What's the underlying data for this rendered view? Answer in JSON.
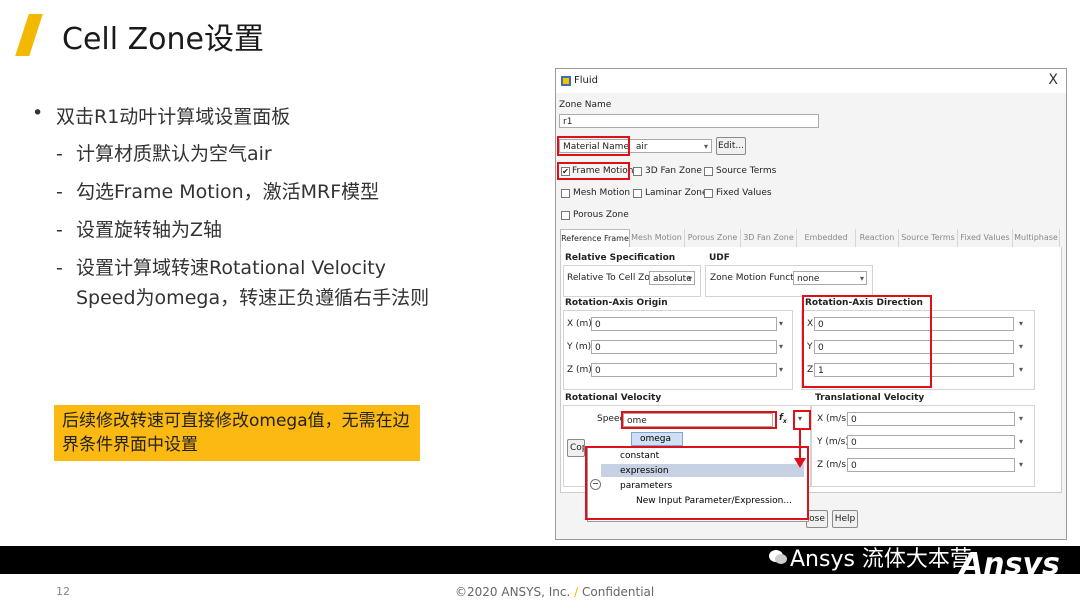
{
  "slide": {
    "title": "Cell Zone设置",
    "bullets": {
      "main": "双击R1动叶计算域设置面板",
      "sub1": "计算材质默认为空气air",
      "sub2": "勾选Frame Motion，激活MRF模型",
      "sub3": "设置旋转轴为Z轴",
      "sub4": "设置计算域转速Rotational Velocity Speed为omega，转速正负遵循右手法则"
    },
    "note": "后续修改转速可直接修改omega值，无需在边界条件界面中设置",
    "dash": "-",
    "page_number": "12",
    "copyright": "©2020 ANSYS, Inc.",
    "copyright_slash": "/",
    "confidential": "Confidential",
    "watermark": "Ansys 流体大本营",
    "logo_text": "Ansys",
    "accent_color": "#f3b800",
    "note_bg": "#fbb911"
  },
  "dialog": {
    "title": "Fluid",
    "close_glyph": "X",
    "zone_name_label": "Zone Name",
    "zone_name_value": "r1",
    "material_label": "Material Name",
    "material_value": "air",
    "edit_button": "Edit...",
    "checkboxes": {
      "frame_motion": "Frame Motion",
      "fan_zone": "3D Fan Zone",
      "source_terms": "Source Terms",
      "mesh_motion": "Mesh Motion",
      "laminar_zone": "Laminar Zone",
      "fixed_values": "Fixed Values",
      "porous_zone": "Porous Zone"
    },
    "frame_motion_checked": true,
    "check_glyph": "✔",
    "tabs": [
      "Reference Frame",
      "Mesh Motion",
      "Porous Zone",
      "3D Fan Zone",
      "Embedded LES",
      "Reaction",
      "Source Terms",
      "Fixed Values",
      "Multiphase"
    ],
    "relative_spec_header": "Relative Specification",
    "relative_to_label": "Relative To Cell Zone",
    "relative_to_value": "absolute",
    "udf_header": "UDF",
    "zone_motion_label": "Zone Motion Function",
    "zone_motion_value": "none",
    "origin_header": "Rotation-Axis Origin",
    "origin": {
      "x_label": "X (m)",
      "x": "0",
      "y_label": "Y (m)",
      "y": "0",
      "z_label": "Z (m)",
      "z": "0"
    },
    "direction_header": "Rotation-Axis Direction",
    "direction": {
      "x_label": "X",
      "x": "0",
      "y_label": "Y",
      "y": "0",
      "z_label": "Z",
      "z": "1"
    },
    "rot_vel_header": "Rotational Velocity",
    "speed_label": "Speed",
    "speed_value": "ome",
    "fx_glyph": "f",
    "fx_sub": "x",
    "autocomplete": "omega",
    "copy_button": "Cop",
    "trans_vel_header": "Translational Velocity",
    "trans": {
      "x_label": "X (m/s)",
      "x": "0",
      "y_label": "Y (m/s)",
      "y": "0",
      "z_label": "Z (m/s)",
      "z": "0"
    },
    "popup": {
      "constant": "constant",
      "expression": "expression",
      "parameters": "parameters",
      "new_param": "New Input Parameter/Expression...",
      "collapse_glyph": "−"
    },
    "close_button_partial": "ose",
    "help_button": "Help"
  }
}
